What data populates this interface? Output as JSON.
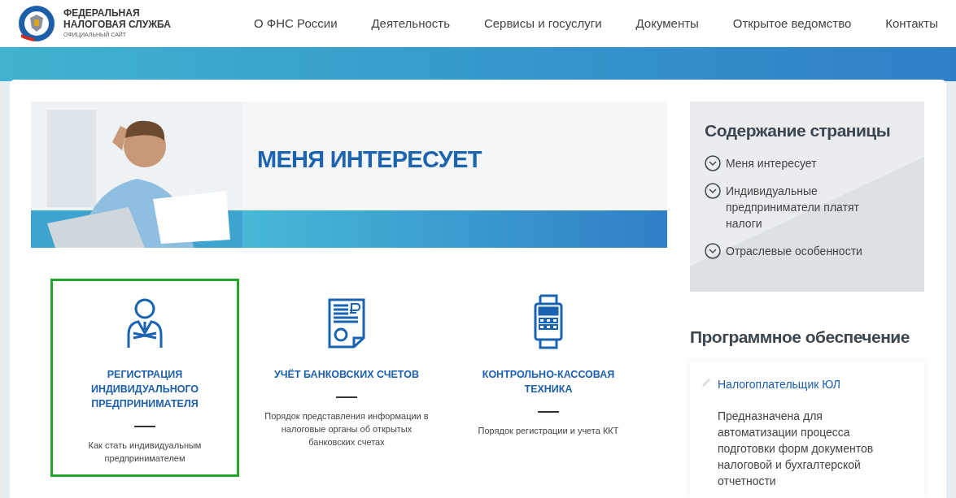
{
  "header": {
    "logo_title": "ФЕДЕРАЛЬНАЯ НАЛОГОВАЯ СЛУЖБА",
    "logo_subtitle": "ОФИЦИАЛЬНЫЙ САЙТ",
    "nav": [
      {
        "label": "О ФНС России"
      },
      {
        "label": "Деятельность"
      },
      {
        "label": "Сервисы и госуслуги"
      },
      {
        "label": "Документы"
      },
      {
        "label": "Открытое ведомство"
      },
      {
        "label": "Контакты"
      }
    ]
  },
  "banner": {
    "title": "МЕНЯ ИНТЕРЕСУЕТ"
  },
  "topics": [
    {
      "kind": "person",
      "title": "РЕГИСТРАЦИЯ ИНДИВИДУАЛЬНОГО ПРЕДПРИНИМАТЕЛЯ",
      "description": "Как стать индивидуальным предпринимателем",
      "selected": true
    },
    {
      "kind": "document",
      "title": "УЧЁТ БАНКОВСКИХ СЧЕТОВ",
      "description": "Порядок представления информации в налоговые органы об открытых банковских счетах",
      "selected": false
    },
    {
      "kind": "terminal",
      "title": "КОНТРОЛЬНО-КАССОВАЯ ТЕХНИКА",
      "description": "Порядок регистрации и учета ККТ",
      "selected": false
    }
  ],
  "contents": {
    "title": "Содержание страницы",
    "items": [
      {
        "label": "Меня интересует"
      },
      {
        "label": "Индивидуальные предприниматели платят налоги"
      },
      {
        "label": "Отраслевые особенности"
      }
    ]
  },
  "software": {
    "title": "Программное обеспечение",
    "item": {
      "name": "Налогоплательщик ЮЛ",
      "description": "Предназначена для автоматизации процесса подготовки форм документов налоговой и бухгалтерской отчетности"
    }
  }
}
